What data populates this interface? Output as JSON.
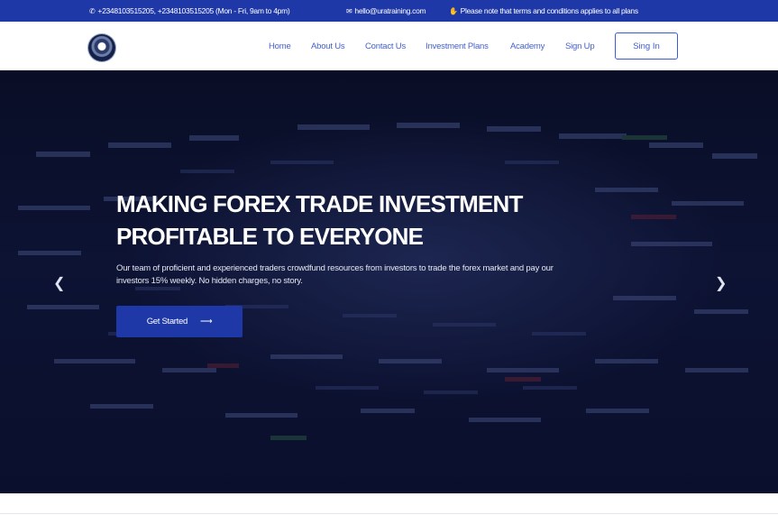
{
  "topbar": {
    "phone_icon": "phone-icon",
    "phone": "+2348103515205, +2348103515205 (Mon - Fri, 9am to 4pm)",
    "email_icon": "envelope-icon",
    "email": "hello@uratraining.com",
    "notice_icon": "handshake-icon",
    "notice": "Please note that terms and conditions applies to all plans"
  },
  "nav": {
    "links": [
      "Home",
      "About Us",
      "Contact Us",
      "Investment Plans",
      "Academy",
      "Sign Up"
    ],
    "signin": "Sing In"
  },
  "hero": {
    "headline_line1": "MAKING  FOREX TRADE  INVESTMENT",
    "headline_line2": "PROFITABLE TO  EVERYONE",
    "subtext": "Our team of proficient and experienced traders crowdfund resources from investors to trade the forex market and pay our investors 15% weekly.  No hidden charges, no story.",
    "cta": "Get Started",
    "cta_icon": "arrow-right-icon",
    "prev_icon": "chevron-left-icon",
    "next_icon": "chevron-right-icon"
  },
  "colors": {
    "topbar_bg": "#1f38a8",
    "nav_link": "#4561c9",
    "accent": "#3b5bd6",
    "hero_bg": "#0c1230"
  }
}
